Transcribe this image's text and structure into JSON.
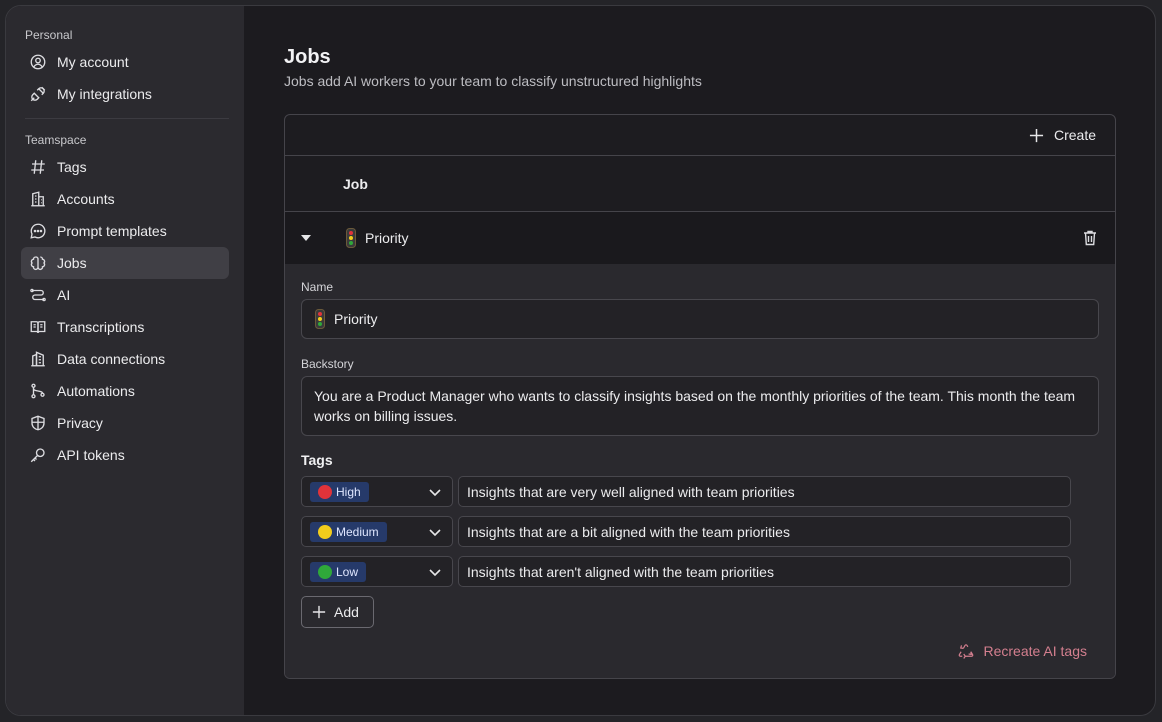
{
  "sidebar": {
    "personal_label": "Personal",
    "personal_items": [
      {
        "label": "My account",
        "icon": "user-circle-icon"
      },
      {
        "label": "My integrations",
        "icon": "plug-icon"
      }
    ],
    "teamspace_label": "Teamspace",
    "teamspace_items": [
      {
        "label": "Tags",
        "icon": "hash-icon"
      },
      {
        "label": "Accounts",
        "icon": "building-icon"
      },
      {
        "label": "Prompt templates",
        "icon": "chat-bubble-icon"
      },
      {
        "label": "Jobs",
        "icon": "brain-icon",
        "active": true
      },
      {
        "label": "AI",
        "icon": "route-icon"
      },
      {
        "label": "Transcriptions",
        "icon": "book-icon"
      },
      {
        "label": "Data connections",
        "icon": "buildings-icon"
      },
      {
        "label": "Automations",
        "icon": "git-branch-icon"
      },
      {
        "label": "Privacy",
        "icon": "shield-icon"
      },
      {
        "label": "API tokens",
        "icon": "key-icon"
      }
    ]
  },
  "page": {
    "title": "Jobs",
    "subtitle": "Jobs add AI workers to your team to classify unstructured highlights"
  },
  "panel": {
    "create_label": "Create",
    "column_header": "Job",
    "job": {
      "name": "Priority",
      "icon": "traffic-light-icon",
      "name_label": "Name",
      "name_value": "Priority",
      "backstory_label": "Backstory",
      "backstory_value": "You are a Product Manager who wants to classify insights based on the monthly priorities of the team. This month the team works on billing issues.",
      "tags_label": "Tags",
      "tags": [
        {
          "label": "High",
          "color": "#e0333a",
          "description": "Insights that are very well aligned with team priorities"
        },
        {
          "label": "Medium",
          "color": "#f2cc1c",
          "description": "Insights that are a bit aligned with the team priorities"
        },
        {
          "label": "Low",
          "color": "#2fa83a",
          "description": "Insights that aren't aligned with the team priorities"
        }
      ],
      "add_label": "Add",
      "recreate_label": "Recreate AI tags"
    }
  }
}
